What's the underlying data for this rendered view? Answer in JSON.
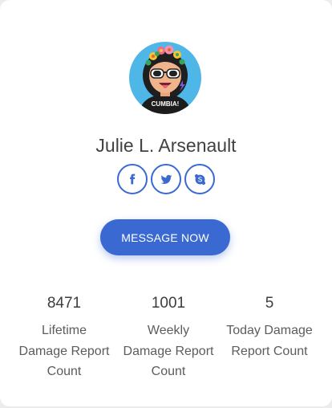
{
  "profile": {
    "name": "Julie L. Arsenault",
    "avatar_shirt_text": "CUMBIA!"
  },
  "socials": [
    {
      "icon": "facebook-icon"
    },
    {
      "icon": "twitter-icon"
    },
    {
      "icon": "skype-icon"
    }
  ],
  "actions": {
    "message_label": "MESSAGE NOW"
  },
  "stats": [
    {
      "value": "8471",
      "label": "Lifetime Damage Report Count",
      "label_lines": [
        "Lifetime",
        "Damage Report",
        "Count"
      ]
    },
    {
      "value": "1001",
      "label": "Weekly Damage Report Count",
      "label_lines": [
        "Weekly",
        "Damage Report",
        "Count"
      ]
    },
    {
      "value": "5",
      "label": "Today Damage Report Count",
      "label_lines": [
        "Today Damage",
        "Report Count"
      ]
    }
  ],
  "colors": {
    "accent": "#3a6ad1",
    "avatar_bg": "#4fb6e8"
  }
}
